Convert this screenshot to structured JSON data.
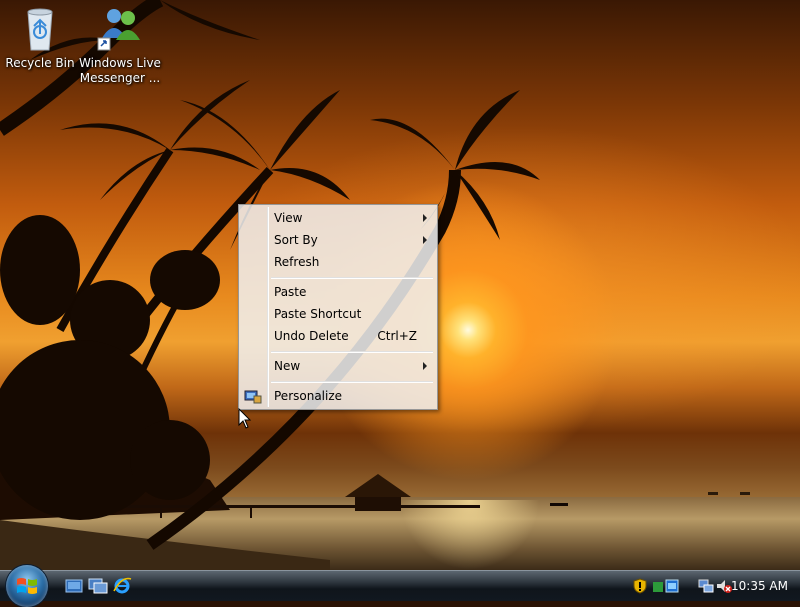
{
  "desktop": {
    "icons": [
      {
        "label": "Recycle Bin",
        "icon": "recycle-bin-icon"
      },
      {
        "label": "Windows Live Messenger ...",
        "icon": "messenger-icon"
      }
    ]
  },
  "context_menu": {
    "items": [
      {
        "label": "View",
        "submenu": true
      },
      {
        "label": "Sort By",
        "submenu": true
      },
      {
        "label": "Refresh"
      },
      {
        "label": "Paste"
      },
      {
        "label": "Paste Shortcut"
      },
      {
        "label": "Undo Delete",
        "shortcut": "Ctrl+Z"
      },
      {
        "label": "New",
        "submenu": true
      },
      {
        "label": "Personalize",
        "icon": "personalize-icon"
      }
    ]
  },
  "taskbar": {
    "start_icon": "windows-logo-icon",
    "quick_launch": [
      "show-desktop-icon",
      "switch-windows-icon",
      "internet-explorer-icon"
    ],
    "tray_icons": [
      "security-shield-icon",
      "network-icon",
      "speaker-muted-icon"
    ],
    "clock": "10:35 AM"
  },
  "colors": {
    "menu_bg": "#f0f0f0",
    "taskbar": "#1a2128",
    "sky": "#e88a1e"
  }
}
